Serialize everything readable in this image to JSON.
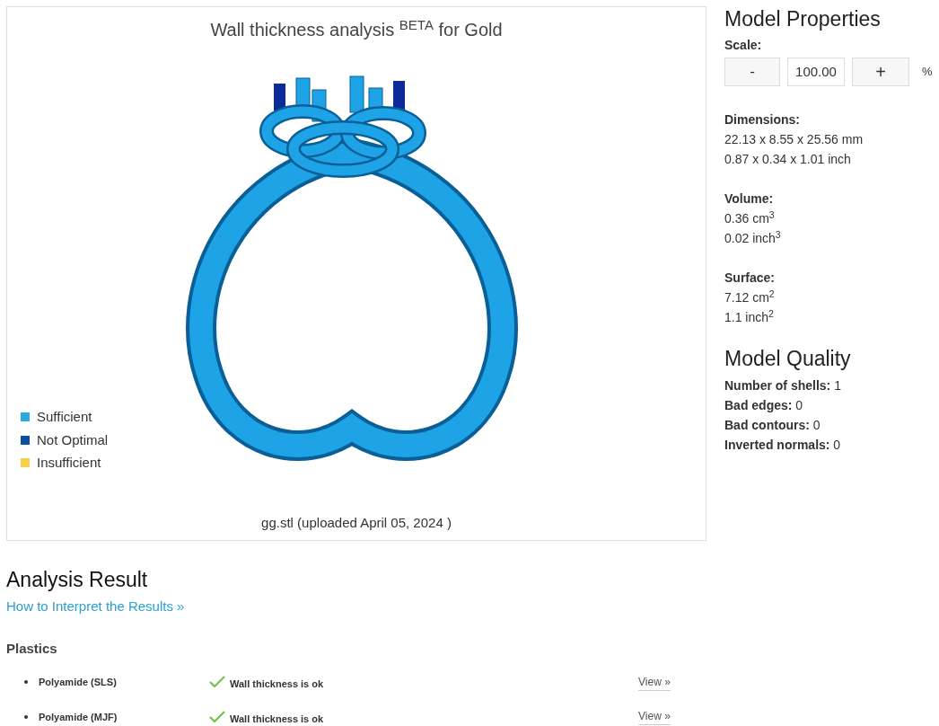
{
  "viewer": {
    "title": "Wall thickness analysis $^{BETA}$ for Gold",
    "legend": [
      {
        "label": "Sufficient",
        "color": "#29abe2"
      },
      {
        "label": "Not Optimal",
        "color": "#0b4ea2"
      },
      {
        "label": "Insufficient",
        "color": "#f7cf4a"
      }
    ],
    "caption": "gg.stl (uploaded April 05, 2024 )"
  },
  "properties": {
    "heading": "Model Properties",
    "scale": {
      "label": "Scale:",
      "decrement": "-",
      "value": "100.00",
      "increment": "+",
      "unit": "%"
    },
    "groups": [
      {
        "label": "Dimensions:",
        "lines": [
          "22.13 x 8.55 x 25.56 mm",
          "0.87 x 0.34 x 1.01 inch"
        ]
      },
      {
        "label": "Volume:",
        "lines": [
          "0.36 cm$^{3}$",
          "0.02 inch$^{3}$"
        ]
      },
      {
        "label": "Surface:",
        "lines": [
          "7.12 cm$^{2}$",
          "1.1 inch$^{2}$"
        ]
      }
    ]
  },
  "quality": {
    "heading": "Model Quality",
    "items": [
      "**Number of shells:** 1",
      "**Bad edges:** 0",
      "**Bad contours:** 0",
      "**Inverted normals:** 0"
    ]
  },
  "analysis": {
    "heading": "Analysis Result",
    "link": "How to Interpret the Results »",
    "category": "Plastics",
    "rows": [
      {
        "material": "Polyamide (SLS)",
        "status": "Wall thickness is ok",
        "action": "View »"
      },
      {
        "material": "Polyamide (MJF)",
        "status": "Wall thickness is ok",
        "action": "View »"
      }
    ]
  }
}
